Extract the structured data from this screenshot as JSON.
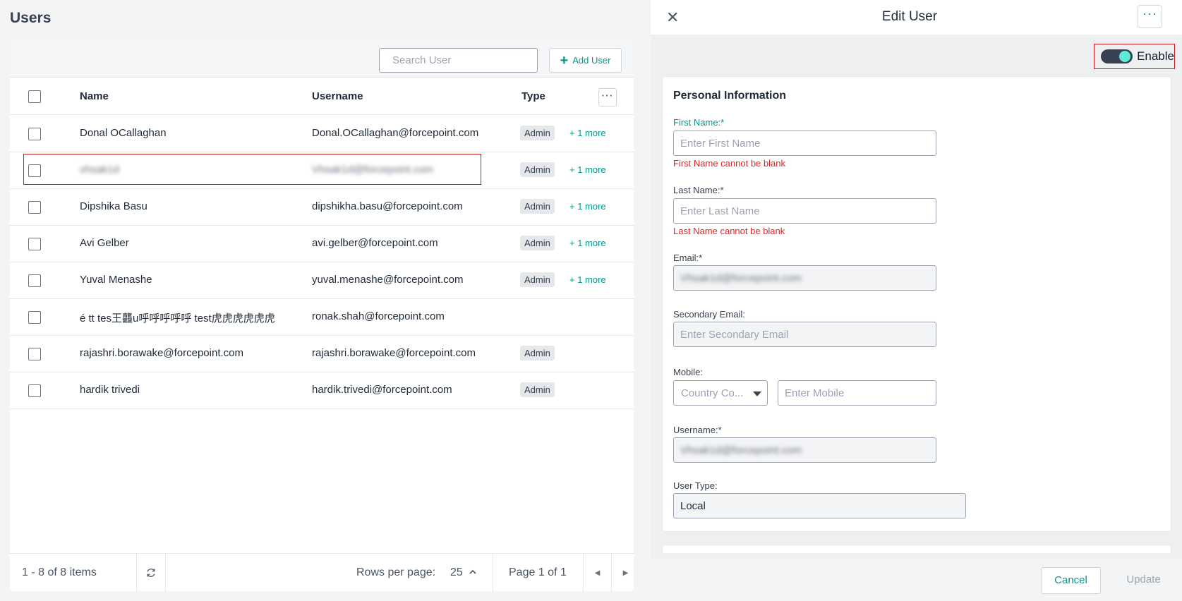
{
  "page": {
    "title": "Users"
  },
  "toolbar": {
    "search_placeholder": "Search User",
    "add_user_label": "Add User"
  },
  "table": {
    "columns": {
      "name": "Name",
      "username": "Username",
      "type": "Type"
    },
    "rows": [
      {
        "name": "Donal OCallaghan",
        "username": "Donal.OCallaghan@forcepoint.com",
        "type": "Admin",
        "more": "+ 1 more"
      },
      {
        "name": "vhsak1d",
        "username": "Vhsak1d@forcepoint.com",
        "type": "Admin",
        "more": "+ 1 more"
      },
      {
        "name": "Dipshika Basu",
        "username": "dipshikha.basu@forcepoint.com",
        "type": "Admin",
        "more": "+ 1 more"
      },
      {
        "name": "Avi Gelber",
        "username": "avi.gelber@forcepoint.com",
        "type": "Admin",
        "more": "+ 1 more"
      },
      {
        "name": "Yuval Menashe",
        "username": "yuval.menashe@forcepoint.com",
        "type": "Admin",
        "more": "+ 1 more"
      },
      {
        "name": "é tt tes王龘u呼呼呼呼呼 test虎虎虎虎虎虎",
        "username": "ronak.shah@forcepoint.com",
        "type": "",
        "more": ""
      },
      {
        "name": "rajashri.borawake@forcepoint.com",
        "username": "rajashri.borawake@forcepoint.com",
        "type": "Admin",
        "more": ""
      },
      {
        "name": "hardik trivedi",
        "username": "hardik.trivedi@forcepoint.com",
        "type": "Admin",
        "more": ""
      }
    ]
  },
  "footer": {
    "items_label": "1 - 8 of 8 items",
    "rows_per_page_label": "Rows per page:",
    "rows_per_page_value": "25",
    "page_label": "Page 1 of 1"
  },
  "edit_user": {
    "title": "Edit User",
    "enable_label": "Enable",
    "enabled": true,
    "section_title": "Personal Information",
    "first_name_label": "First Name:*",
    "first_name_placeholder": "Enter First Name",
    "first_name_error": "First Name cannot be blank",
    "last_name_label": "Last Name:*",
    "last_name_placeholder": "Enter Last Name",
    "last_name_error": "Last Name cannot be blank",
    "email_label": "Email:*",
    "email_value": "Vhsak1d@forcepoint.com",
    "secondary_email_label": "Secondary Email:",
    "secondary_email_placeholder": "Enter Secondary Email",
    "mobile_label": "Mobile:",
    "country_code_placeholder": "Country Co...",
    "mobile_placeholder": "Enter Mobile",
    "username_label": "Username:*",
    "username_value": "Vhsak1d@forcepoint.com",
    "user_type_label": "User Type:",
    "user_type_value": "Local",
    "cancel_label": "Cancel",
    "update_label": "Update"
  },
  "colors": {
    "accent": "#0d9488",
    "error": "#dc2626",
    "highlight": "#c81e1e"
  }
}
